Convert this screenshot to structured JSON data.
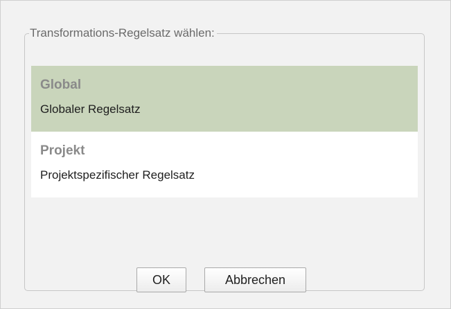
{
  "dialog": {
    "group_title": "Transformations-Regelsatz wählen:",
    "options": [
      {
        "title": "Global",
        "description": "Globaler Regelsatz",
        "selected": true
      },
      {
        "title": "Projekt",
        "description": "Projektspezifischer Regelsatz",
        "selected": false
      }
    ],
    "ok_label": "OK",
    "cancel_label": "Abbrechen"
  },
  "colors": {
    "selected_background": "#c9d5bb",
    "dialog_background": "#f2f2f2"
  }
}
